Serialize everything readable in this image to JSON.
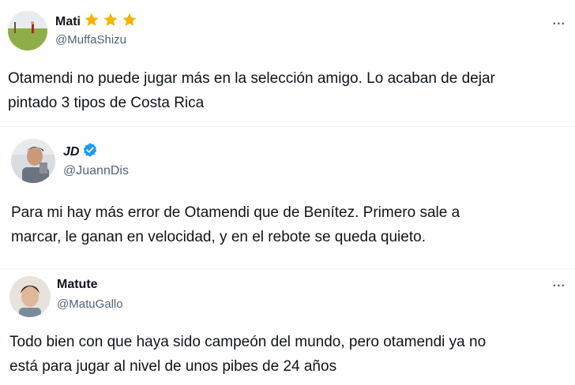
{
  "tweets": [
    {
      "name": "Mati",
      "handle": "@MuffaShizu",
      "text_lines": [
        "Otamendi no puede jugar más en la selección amigo. Lo acaban de dejar",
        "pintado 3 tipos de Costa Rica"
      ],
      "badge": "three-star-icons",
      "more": "..."
    },
    {
      "name": "JD",
      "handle": "@JuannDis",
      "text_lines": [
        "Para mi hay más error de Otamendi que de Benítez. Primero sale a",
        "marcar, le ganan en velocidad, y en el rebote se queda quieto."
      ],
      "badge": "verified-icon"
    },
    {
      "name": "Matute",
      "handle": "@MatuGallo",
      "text_lines": [
        "Todo bien con que haya sido campeón del mundo, pero otamendi ya no",
        "está para jugar al nivel de unos pibes de 24 años"
      ],
      "more": "..."
    }
  ],
  "colors": {
    "star": "#f5b400",
    "verified": "#1d9bf0",
    "handle": "#536471"
  }
}
